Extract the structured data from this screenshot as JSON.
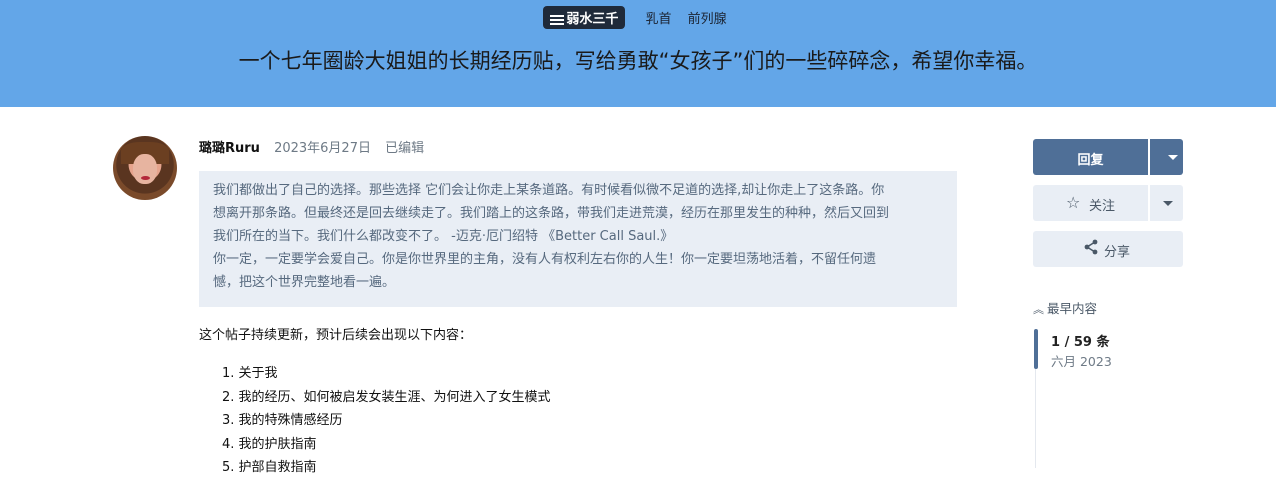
{
  "header": {
    "category": "弱水三千",
    "tags": [
      "乳首",
      "前列腺"
    ],
    "title": "一个七年圈龄大姐姐的长期经历贴，写给勇敢“女孩子”们的一些碎碎念，希望你幸福。"
  },
  "post": {
    "username": "璐璐Ruru",
    "date": "2023年6月27日",
    "edited": "已编辑",
    "quote_lines": [
      "我们都做出了自己的选择。那些选择 它们会让你走上某条道路。有时候看似微不足道的选择,却让你走上了这条路。你",
      "想离开那条路。但最终还是回去继续走了。我们踏上的这条路，带我们走进荒漠，经历在那里发生的种种，然后又回到",
      "我们所在的当下。我们什么都改变不了。 -迈克·厄门绍特 《Better Call Saul.》",
      "你一定，一定要学会爱自己。你是你世界里的主角，没有人有权利左右你的人生！你一定要坦荡地活着，不留任何遗",
      "憾，把这个世界完整地看一遍。"
    ],
    "intro": "这个帖子持续更新，预计后续会出现以下内容：",
    "list": [
      "1. 关于我",
      "2. 我的经历、如何被启发女装生涯、为何进入了女生模式",
      "3. 我的特殊情感经历",
      "4. 我的护肤指南",
      "5. 护部自救指南"
    ]
  },
  "sidebar": {
    "reply_label": "回复",
    "watch_label": "关注",
    "share_label": "分享",
    "earliest_label": "最早内容",
    "timeline_count": "1 / 59 条",
    "timeline_date": "六月 2023"
  },
  "icons": {
    "category": "bars-icon",
    "watch": "star-icon",
    "share": "share-icon",
    "earliest": "double-chevron-up-icon"
  },
  "colors": {
    "hero_bg": "#63a6e8",
    "primary": "#4f6f97",
    "quote_bg": "#e9eef5"
  }
}
